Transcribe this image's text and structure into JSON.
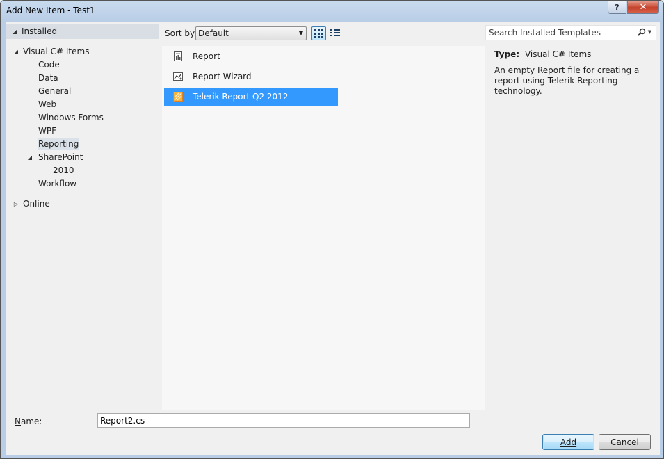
{
  "window": {
    "title": "Add New Item - Test1",
    "help_glyph": "?",
    "close_glyph": "✕"
  },
  "tree": {
    "installed": "Installed",
    "nodes": [
      {
        "label": "Visual C# Items"
      },
      {
        "label": "Code"
      },
      {
        "label": "Data"
      },
      {
        "label": "General"
      },
      {
        "label": "Web"
      },
      {
        "label": "Windows Forms"
      },
      {
        "label": "WPF"
      },
      {
        "label": "Reporting"
      },
      {
        "label": "SharePoint"
      },
      {
        "label": "2010"
      },
      {
        "label": "Workflow"
      },
      {
        "label": "Online"
      }
    ],
    "selected": "Reporting"
  },
  "toolbar": {
    "sort_label": "Sort by:",
    "sort_value": "Default"
  },
  "templates": [
    {
      "label": "Report",
      "icon": "report-icon"
    },
    {
      "label": "Report Wizard",
      "icon": "report-wizard-icon"
    },
    {
      "label": "Telerik Report Q2 2012",
      "icon": "telerik-report-icon"
    }
  ],
  "selected_template": "Telerik Report Q2 2012",
  "search": {
    "placeholder": "Search Installed Templates"
  },
  "details": {
    "type_label": "Type:",
    "type_value": "Visual C# Items",
    "description": "An empty Report file for creating a report using Telerik Reporting  technology."
  },
  "name": {
    "label": "Name:",
    "value": "Report2.cs"
  },
  "buttons": {
    "add": "Add",
    "cancel": "Cancel"
  },
  "colors": {
    "selection": "#3399ff",
    "accent_border": "#3c7fb1"
  }
}
